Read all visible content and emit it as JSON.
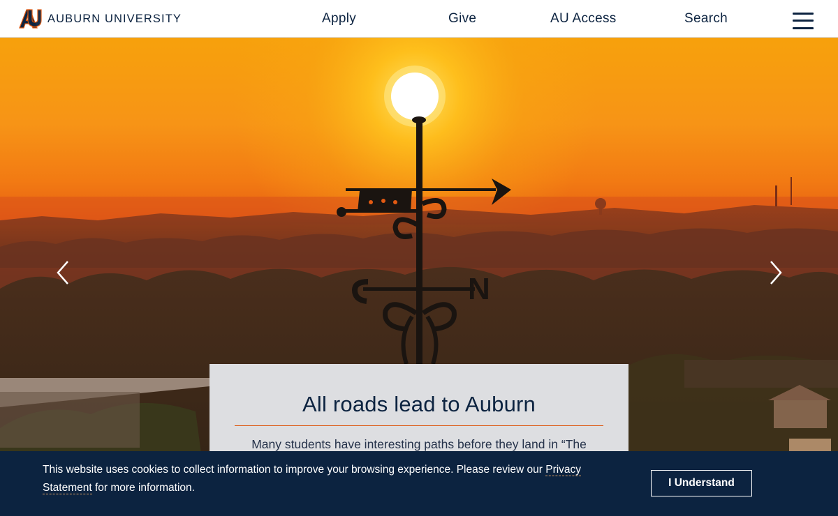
{
  "header": {
    "brand": "AUBURN UNIVERSITY",
    "brand_icon": "au-logo-icon",
    "nav": {
      "apply": "Apply",
      "give": "Give",
      "au_access": "AU Access",
      "search": "Search"
    },
    "menu_icon": "hamburger-menu-icon"
  },
  "hero": {
    "icons": {
      "prev": "chevron-left-icon",
      "next": "chevron-right-icon"
    },
    "weathervane_letter": "N",
    "story": {
      "title": "All roads lead to Auburn",
      "text": "Many students have interesting paths before they land in “The"
    }
  },
  "cookie_banner": {
    "text_before": "This website uses cookies to collect information to improve your browsing experience. Please review our ",
    "link": "Privacy Statement",
    "text_after": " for more information.",
    "button": "I Understand"
  },
  "colors": {
    "navy": "#0c2340",
    "orange": "#dd550c",
    "white": "#ffffff"
  }
}
